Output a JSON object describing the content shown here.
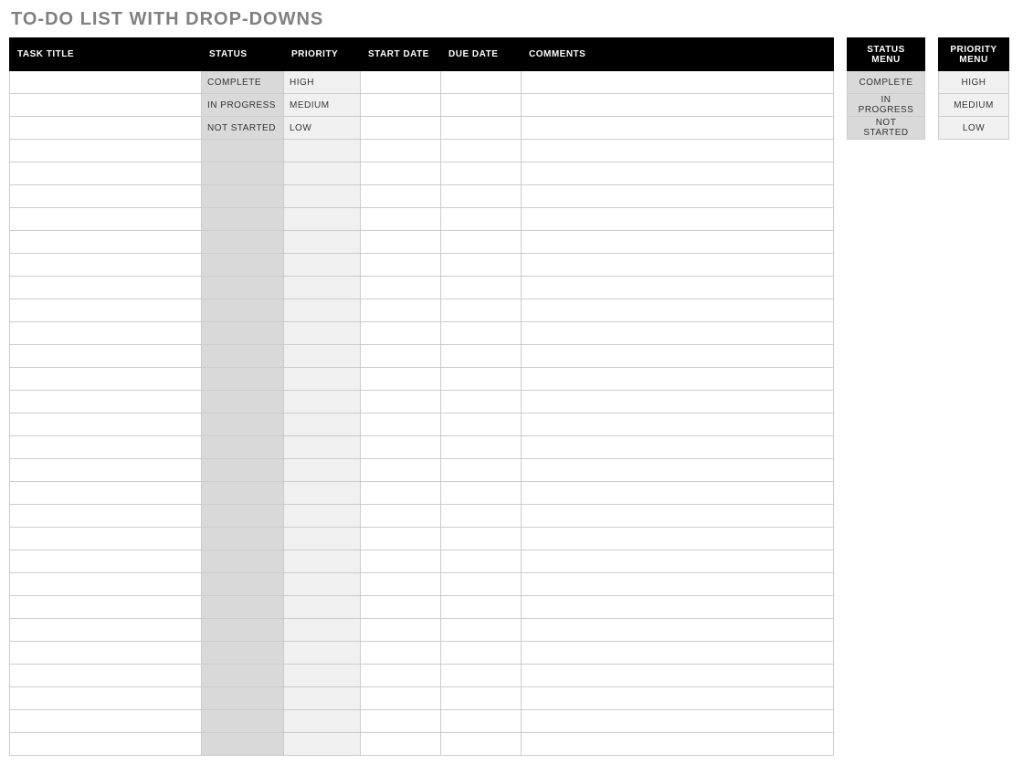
{
  "title": "TO-DO LIST WITH DROP-DOWNS",
  "headers": {
    "task": "TASK TITLE",
    "status": "STATUS",
    "priority": "PRIORITY",
    "start": "START DATE",
    "due": "DUE DATE",
    "comments": "COMMENTS"
  },
  "rows": [
    {
      "task": "",
      "status": "COMPLETE",
      "priority": "HIGH",
      "start": "",
      "due": "",
      "comments": ""
    },
    {
      "task": "",
      "status": "IN PROGRESS",
      "priority": "MEDIUM",
      "start": "",
      "due": "",
      "comments": ""
    },
    {
      "task": "",
      "status": "NOT STARTED",
      "priority": "LOW",
      "start": "",
      "due": "",
      "comments": ""
    },
    {
      "task": "",
      "status": "",
      "priority": "",
      "start": "",
      "due": "",
      "comments": ""
    },
    {
      "task": "",
      "status": "",
      "priority": "",
      "start": "",
      "due": "",
      "comments": ""
    },
    {
      "task": "",
      "status": "",
      "priority": "",
      "start": "",
      "due": "",
      "comments": ""
    },
    {
      "task": "",
      "status": "",
      "priority": "",
      "start": "",
      "due": "",
      "comments": ""
    },
    {
      "task": "",
      "status": "",
      "priority": "",
      "start": "",
      "due": "",
      "comments": ""
    },
    {
      "task": "",
      "status": "",
      "priority": "",
      "start": "",
      "due": "",
      "comments": ""
    },
    {
      "task": "",
      "status": "",
      "priority": "",
      "start": "",
      "due": "",
      "comments": ""
    },
    {
      "task": "",
      "status": "",
      "priority": "",
      "start": "",
      "due": "",
      "comments": ""
    },
    {
      "task": "",
      "status": "",
      "priority": "",
      "start": "",
      "due": "",
      "comments": ""
    },
    {
      "task": "",
      "status": "",
      "priority": "",
      "start": "",
      "due": "",
      "comments": ""
    },
    {
      "task": "",
      "status": "",
      "priority": "",
      "start": "",
      "due": "",
      "comments": ""
    },
    {
      "task": "",
      "status": "",
      "priority": "",
      "start": "",
      "due": "",
      "comments": ""
    },
    {
      "task": "",
      "status": "",
      "priority": "",
      "start": "",
      "due": "",
      "comments": ""
    },
    {
      "task": "",
      "status": "",
      "priority": "",
      "start": "",
      "due": "",
      "comments": ""
    },
    {
      "task": "",
      "status": "",
      "priority": "",
      "start": "",
      "due": "",
      "comments": ""
    },
    {
      "task": "",
      "status": "",
      "priority": "",
      "start": "",
      "due": "",
      "comments": ""
    },
    {
      "task": "",
      "status": "",
      "priority": "",
      "start": "",
      "due": "",
      "comments": ""
    },
    {
      "task": "",
      "status": "",
      "priority": "",
      "start": "",
      "due": "",
      "comments": ""
    },
    {
      "task": "",
      "status": "",
      "priority": "",
      "start": "",
      "due": "",
      "comments": ""
    },
    {
      "task": "",
      "status": "",
      "priority": "",
      "start": "",
      "due": "",
      "comments": ""
    },
    {
      "task": "",
      "status": "",
      "priority": "",
      "start": "",
      "due": "",
      "comments": ""
    },
    {
      "task": "",
      "status": "",
      "priority": "",
      "start": "",
      "due": "",
      "comments": ""
    },
    {
      "task": "",
      "status": "",
      "priority": "",
      "start": "",
      "due": "",
      "comments": ""
    },
    {
      "task": "",
      "status": "",
      "priority": "",
      "start": "",
      "due": "",
      "comments": ""
    },
    {
      "task": "",
      "status": "",
      "priority": "",
      "start": "",
      "due": "",
      "comments": ""
    },
    {
      "task": "",
      "status": "",
      "priority": "",
      "start": "",
      "due": "",
      "comments": ""
    },
    {
      "task": "",
      "status": "",
      "priority": "",
      "start": "",
      "due": "",
      "comments": ""
    }
  ],
  "status_menu": {
    "header": "STATUS MENU",
    "items": [
      "COMPLETE",
      "IN PROGRESS",
      "NOT STARTED"
    ]
  },
  "priority_menu": {
    "header": "PRIORITY MENU",
    "items": [
      "HIGH",
      "MEDIUM",
      "LOW"
    ]
  }
}
